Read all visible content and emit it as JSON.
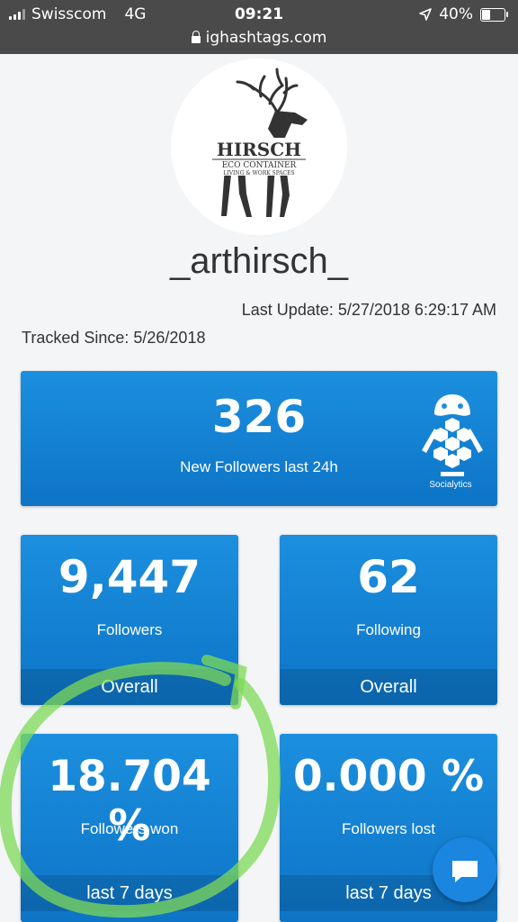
{
  "status_bar": {
    "carrier": "Swisscom",
    "network": "4G",
    "time": "09:21",
    "battery": "40%",
    "battery_level": 0.4
  },
  "url_bar": {
    "url": "ighashtags.com"
  },
  "profile": {
    "logo_text": {
      "brand": "HIRSCH",
      "line1": "ECO CONTAINER",
      "line2": "LIVING & WORK SPACES"
    },
    "username": "_arthirsch_",
    "last_update": "Last Update: 5/27/2018 6:29:17 AM",
    "tracked_since": "Tracked Since: 5/26/2018"
  },
  "stats": {
    "new_followers": {
      "value": "326",
      "label": "New Followers last 24h",
      "badge": "Socialytics"
    },
    "followers": {
      "value": "9,447",
      "label": "Followers",
      "period": "Overall"
    },
    "following": {
      "value": "62",
      "label": "Following",
      "period": "Overall"
    },
    "followers_won": {
      "value": "18.704 %",
      "label": "Followers won",
      "period": "last 7 days"
    },
    "followers_lost": {
      "value": "0.000 %",
      "label": "Followers lost",
      "period": "last 7 days"
    }
  },
  "colors": {
    "card_top": "#1c8fdf",
    "card_bottom": "#0d74c6",
    "status_bar": "#4a4a4a",
    "annotation": "#7ed957"
  },
  "icons": [
    "signal-icon",
    "location-arrow-icon",
    "battery-icon",
    "lock-icon",
    "chat-bubble-icon"
  ]
}
